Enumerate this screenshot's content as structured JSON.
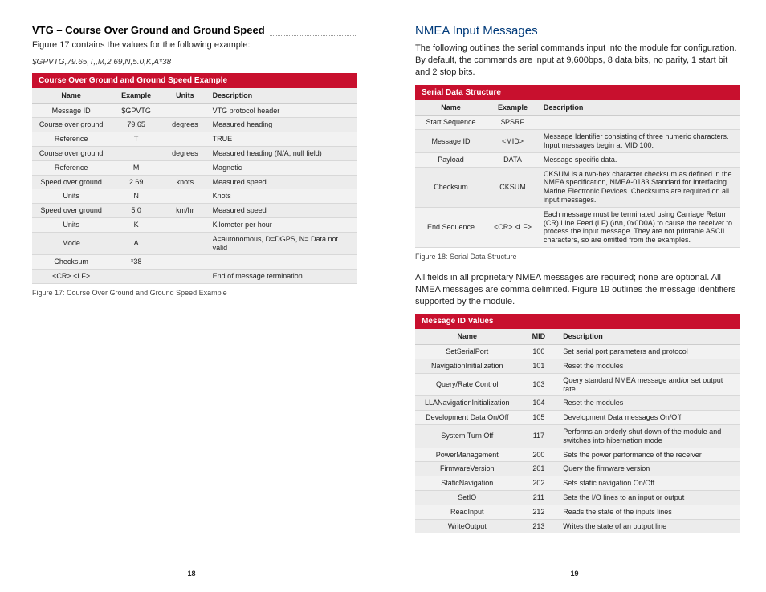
{
  "left": {
    "heading": "VTG – Course Over Ground and Ground Speed",
    "intro": "Figure 17 contains the values for the following example:",
    "sample": "$GPVTG,79.65,T,,M,2.69,N,5.0,K,A*38",
    "table1": {
      "title": "Course Over Ground and Ground Speed Example",
      "cols": [
        "Name",
        "Example",
        "Units",
        "Description"
      ],
      "rows": [
        [
          "Message ID",
          "$GPVTG",
          "",
          "VTG protocol header"
        ],
        [
          "Course over ground",
          "79.65",
          "degrees",
          "Measured heading"
        ],
        [
          "Reference",
          "T",
          "",
          "TRUE"
        ],
        [
          "Course over ground",
          "",
          "degrees",
          "Measured heading (N/A, null field)"
        ],
        [
          "Reference",
          "M",
          "",
          "Magnetic"
        ],
        [
          "Speed over ground",
          "2.69",
          "knots",
          "Measured speed"
        ],
        [
          "Units",
          "N",
          "",
          "Knots"
        ],
        [
          "Speed over ground",
          "5.0",
          "km/hr",
          "Measured speed"
        ],
        [
          "Units",
          "K",
          "",
          "Kilometer per hour"
        ],
        [
          "Mode",
          "A",
          "",
          "A=autonomous, D=DGPS, N= Data not valid"
        ],
        [
          "Checksum",
          "*38",
          "",
          ""
        ],
        [
          "<CR> <LF>",
          "",
          "",
          "End of message termination"
        ]
      ]
    },
    "caption1": "Figure 17: Course Over Ground and Ground Speed Example",
    "pagenum": "– 18 –"
  },
  "right": {
    "heading": "NMEA Input Messages",
    "intro": "The following outlines the serial commands input into the module for configuration. By default, the commands are input at 9,600bps, 8 data bits, no parity, 1 start bit and 2 stop bits.",
    "table2": {
      "title": "Serial Data Structure",
      "cols": [
        "Name",
        "Example",
        "Description"
      ],
      "rows": [
        [
          "Start Sequence",
          "$PSRF",
          ""
        ],
        [
          "Message ID",
          "<MID>",
          "Message Identifier consisting of three numeric characters. Input messages begin at MID 100."
        ],
        [
          "Payload",
          "DATA",
          "Message specific data."
        ],
        [
          "Checksum",
          "CKSUM",
          "CKSUM is a two-hex character checksum as defined in the NMEA specification, NMEA-0183 Standard for Interfacing Marine Electronic Devices. Checksums are required on all input messages."
        ],
        [
          "End Sequence",
          "<CR> <LF>",
          "Each message must be terminated using Carriage Return (CR) Line Feed (LF) (\\r\\n, 0x0D0A) to cause the receiver to process the input message. They are not printable ASCII characters, so are omitted from the examples."
        ]
      ]
    },
    "caption2": "Figure 18: Serial Data Structure",
    "para2": "All fields in all proprietary NMEA messages are required; none are optional. All NMEA messages are comma delimited. Figure 19 outlines the message identifiers supported by the module.",
    "table3": {
      "title": "Message ID Values",
      "cols": [
        "Name",
        "MID",
        "Description"
      ],
      "rows": [
        [
          "SetSerialPort",
          "100",
          "Set serial port parameters and protocol"
        ],
        [
          "NavigationInitialization",
          "101",
          "Reset the modules"
        ],
        [
          "Query/Rate Control",
          "103",
          "Query standard NMEA message and/or set output rate"
        ],
        [
          "LLANavigationInitialization",
          "104",
          "Reset the modules"
        ],
        [
          "Development Data On/Off",
          "105",
          "Development Data messages On/Off"
        ],
        [
          "System Turn Off",
          "117",
          "Performs an orderly shut down of the module and switches into hibernation mode"
        ],
        [
          "PowerManagement",
          "200",
          "Sets the power performance of the receiver"
        ],
        [
          "FirmwareVersion",
          "201",
          "Query the firmware version"
        ],
        [
          "StaticNavigation",
          "202",
          "Sets static navigation On/Off"
        ],
        [
          "SetIO",
          "211",
          "Sets the I/O lines to an input or output"
        ],
        [
          "ReadInput",
          "212",
          "Reads the state of the inputs lines"
        ],
        [
          "WriteOutput",
          "213",
          "Writes the state of an output line"
        ]
      ]
    },
    "pagenum": "– 19 –"
  }
}
